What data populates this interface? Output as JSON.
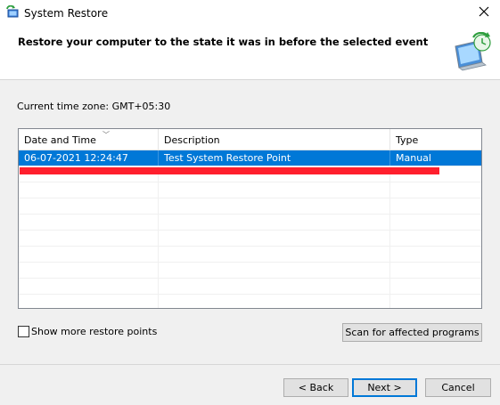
{
  "window": {
    "title": "System Restore",
    "close_icon": "close-icon",
    "app_icon": "system-restore-icon"
  },
  "header": {
    "title": "Restore your computer to the state it was in before the selected event",
    "icon": "system-restore-large-icon"
  },
  "timezone": {
    "text": "Current time zone: GMT+05:30"
  },
  "table": {
    "columns": [
      "Date and Time",
      "Description",
      "Type"
    ],
    "sort_column": "Date and Time",
    "rows": [
      {
        "date": "06-07-2021 12:24:47",
        "description": "Test System Restore Point",
        "type": "Manual",
        "selected": true
      }
    ],
    "selection_color": "#0078d7",
    "annotation_color": "#ff1f2d"
  },
  "options": {
    "show_more_label": "Show more restore points",
    "show_more_checked": false
  },
  "buttons": {
    "scan": "Scan for affected programs",
    "back": "< Back",
    "next": "Next >",
    "cancel": "Cancel"
  }
}
